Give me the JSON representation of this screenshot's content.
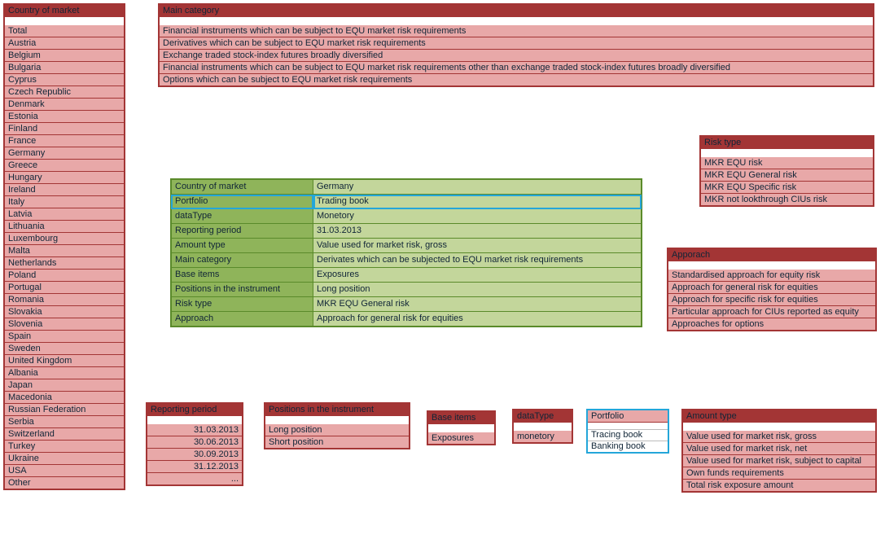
{
  "country_panel": {
    "header": "Country of market",
    "items": [
      "Total",
      "Austria",
      "Belgium",
      "Bulgaria",
      "Cyprus",
      "Czech Republic",
      "Denmark",
      "Estonia",
      "Finland",
      "France",
      "Germany",
      "Greece",
      "Hungary",
      "Ireland",
      "Italy",
      "Latvia",
      "Lithuania",
      "Luxembourg",
      "Malta",
      "Netherlands",
      "Poland",
      "Portugal",
      "Romania",
      "Slovakia",
      "Slovenia",
      "Spain",
      "Sweden",
      "United Kingdom",
      "Albania",
      "Japan",
      "Macedonia",
      "Russian Federation",
      "Serbia",
      "Switzerland",
      "Turkey",
      "Ukraine",
      "USA",
      "Other"
    ]
  },
  "main_category": {
    "header": "Main category",
    "items": [
      "Financial instruments which can be subject to EQU market risk requirements",
      "Derivatives which can be subject to EQU market risk requirements",
      "Exchange traded stock-index futures broadly diversified",
      "Financial instruments which can be subject to EQU market risk requirements other than exchange traded stock-index futures broadly diversified",
      "Options which can be subject to EQU market risk requirements"
    ]
  },
  "risk_type": {
    "header": "Risk type",
    "items": [
      "MKR EQU risk",
      "MKR EQU General risk",
      "MKR EQU Specific risk",
      "MKR not lookthrough CIUs risk"
    ]
  },
  "approach": {
    "header": "Apporach",
    "items": [
      "Standardised approach for equity risk",
      "Approach for general risk for equities",
      "Approach for specific risk for equities",
      "Particular approach for CIUs reported as equity",
      "Approaches for options"
    ]
  },
  "reporting_period": {
    "header": "Reporting period",
    "items": [
      "31.03.2013",
      "30.06.2013",
      "30.09.2013",
      "31.12.2013",
      "..."
    ]
  },
  "positions": {
    "header": "Positions in the instrument",
    "items": [
      "Long position",
      "Short position"
    ]
  },
  "base_items": {
    "header": "Base items",
    "items": [
      "Exposures"
    ]
  },
  "datatype": {
    "header": "dataType",
    "items": [
      "monetory"
    ]
  },
  "portfolio": {
    "header": "Portfolio",
    "items": [
      "Tracing book",
      "Banking book"
    ]
  },
  "amount_type": {
    "header": "Amount type",
    "items": [
      "Value used for market risk, gross",
      "Value used for market risk, net",
      "Value used for market risk, subject to capital",
      "Own funds requirements",
      "Total risk exposure amount"
    ]
  },
  "detail": {
    "rows": [
      {
        "label": "Country of market",
        "value": "Germany"
      },
      {
        "label": "Portfolio",
        "value": "Trading book"
      },
      {
        "label": "dataType",
        "value": "Monetory"
      },
      {
        "label": "Reporting period",
        "value": "31.03.2013"
      },
      {
        "label": "Amount type",
        "value": "Value used for market risk, gross"
      },
      {
        "label": "Main category",
        "value": "Derivates which can be subjected to EQU market risk requirements"
      },
      {
        "label": "Base items",
        "value": "Exposures"
      },
      {
        "label": "Positions in the instrument",
        "value": "Long position"
      },
      {
        "label": "Risk type",
        "value": "MKR EQU General risk"
      },
      {
        "label": "Approach",
        "value": "Approach for general risk for equities"
      }
    ]
  }
}
